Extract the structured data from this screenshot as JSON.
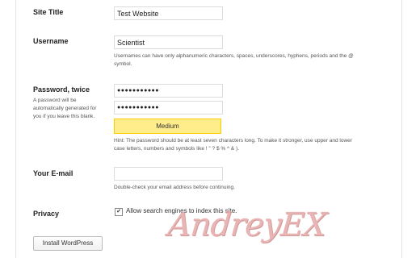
{
  "form": {
    "site_title": {
      "label": "Site Title",
      "value": "Test Website"
    },
    "username": {
      "label": "Username",
      "value": "Scientist",
      "hint_line1": "Usernames can have only alphanumeric characters, spaces, underscores, hyphens, periods and the @",
      "hint_line2": "symbol."
    },
    "password": {
      "label": "Password, twice",
      "side_desc": "A password will be automatically generated for you if you leave this blank.",
      "value1": "●●●●●●●●●●●",
      "value2": "●●●●●●●●●●●",
      "strength": "Medium",
      "hint_line1": "Hint: The password should be at least seven characters long. To make it stronger, use upper and lower",
      "hint_line2": "case letters, numbers and symbols like ! \" ? $ % ^ & )."
    },
    "email": {
      "label": "Your E-mail",
      "value": "",
      "hint": "Double-check your email address before continuing."
    },
    "privacy": {
      "label": "Privacy",
      "checked": true,
      "check_mark": "✔",
      "checkbox_label": "Allow search engines to index this site."
    },
    "submit_label": "Install WordPress"
  },
  "watermark": "AndreyEX",
  "colors": {
    "meter_bg": "#ffec8b",
    "meter_border": "#ffcc00",
    "watermark": "#e6a8a8"
  }
}
